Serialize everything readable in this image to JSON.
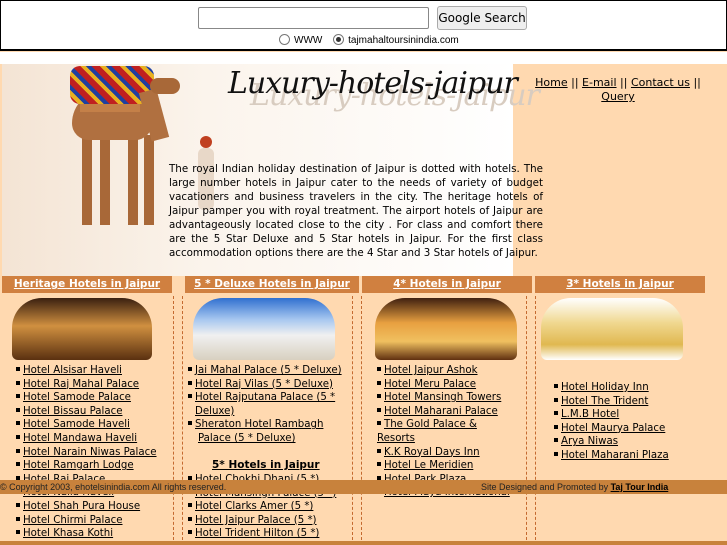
{
  "search": {
    "button": "Google Search",
    "value": "",
    "opt_www": "WWW",
    "opt_site": "tajmahaltoursinindia.com"
  },
  "site_title": "Luxury-hotels-jaipur",
  "nav": {
    "home": "Home",
    "sep1": "||",
    "email": "E-mail",
    "sep2": "||",
    "contact": "Contact us",
    "sep3": "||",
    "query": "Query"
  },
  "intro": "The royal Indian holiday destination of Jaipur is dotted with hotels. The large number hotels in Jaipur cater to the needs of variety of budget vacationers and business travelers in the city. The heritage hotels of Jaipur pamper you with royal treatment. The airport hotels of Jaipur are advantageously located close to the city . For class and comfort there are the 5 Star Deluxe and 5 Star hotels in Jaipur. For the first class accommodation options there are the 4 Star and 3 Star hotels of Jaipur.",
  "columns": {
    "heritage": "Heritage Hotels in Jaipur",
    "deluxe": "5 * Deluxe Hotels in Jaipur",
    "four": "4* Hotels in Jaipur",
    "three": "3* Hotels in Jaipur"
  },
  "heritage_list": [
    "Hotel Alsisar Haveli",
    "Hotel Raj Mahal Palace",
    "Hotel Samode Palace",
    "Hotel Bissau Palace",
    "Hotel Samode Haveli",
    "Hotel Mandawa Haveli",
    "Hotel Narain Niwas Palace",
    "Hotel Ramgarh Lodge",
    "Hotel Raj Palace",
    "Hotel Naila Haveli",
    "Hotel Shah Pura House",
    "Hotel Chirmi Palace",
    "Hotel Khasa Kothi"
  ],
  "deluxe_list": [
    "Jai Mahal Palace (5 * Deluxe)",
    "Hotel Raj Vilas (5 * Deluxe)",
    "Hotel Rajputana Palace (5 *",
    "Deluxe)",
    "Sheraton Hotel Rambagh",
    "Palace (5 * Deluxe)"
  ],
  "five_star_heading": "5* Hotels in Jaipur",
  "five_list": [
    "Hotel Chokhi Dhani (5 *)",
    "Hotel Mansingh Palace (5 *)",
    "Hotel Clarks Amer (5 *)",
    "Hotel Jaipur Palace (5 *)",
    "Hotel Trident Hilton (5 *)"
  ],
  "four_list": [
    "Hotel Jaipur Ashok",
    "Hotel Meru Palace",
    "Hotel Mansingh Towers",
    "Hotel Maharani Palace",
    "The Gold Palace &",
    "Resorts",
    "K.K Royal Days Inn",
    "Hotel Le Meridien",
    "Hotel Park Plaza",
    "Hotel Maya International"
  ],
  "three_list": [
    "Hotel Holiday Inn",
    "Hotel The Trident",
    "L.M.B Hotel",
    "Hotel Maurya Palace",
    "Arya Niwas",
    "Hotel Maharani Plaza"
  ],
  "footer": {
    "copyright": "© Copyright 2003, ehotelsinindia.com All rights reserved.",
    "credit": "Site Designed and Promoted by",
    "credit_link": "Taj Tour India"
  },
  "colors": {
    "bg": "#ffd9b0",
    "accent": "#d08040"
  }
}
